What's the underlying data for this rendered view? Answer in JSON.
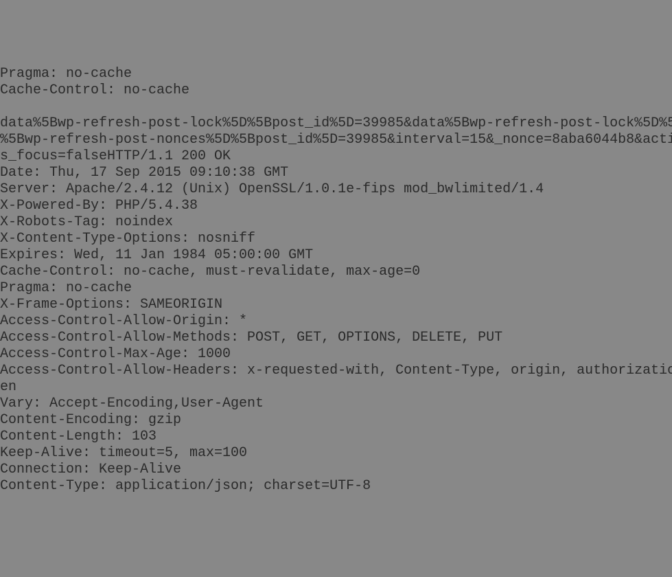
{
  "lines": [
    "Pragma: no-cache",
    "Cache-Control: no-cache",
    "",
    "data%5Bwp-refresh-post-lock%5D%5Bpost_id%5D=39985&data%5Bwp-refresh-post-lock%5D%5",
    "%5Bwp-refresh-post-nonces%5D%5Bpost_id%5D=39985&interval=15&_nonce=8aba6044b8&acti",
    "s_focus=falseHTTP/1.1 200 OK",
    "Date: Thu, 17 Sep 2015 09:10:38 GMT",
    "Server: Apache/2.4.12 (Unix) OpenSSL/1.0.1e-fips mod_bwlimited/1.4",
    "X-Powered-By: PHP/5.4.38",
    "X-Robots-Tag: noindex",
    "X-Content-Type-Options: nosniff",
    "Expires: Wed, 11 Jan 1984 05:00:00 GMT",
    "Cache-Control: no-cache, must-revalidate, max-age=0",
    "Pragma: no-cache",
    "X-Frame-Options: SAMEORIGIN",
    "Access-Control-Allow-Origin: *",
    "Access-Control-Allow-Methods: POST, GET, OPTIONS, DELETE, PUT",
    "Access-Control-Max-Age: 1000",
    "Access-Control-Allow-Headers: x-requested-with, Content-Type, origin, authorizatio",
    "en",
    "Vary: Accept-Encoding,User-Agent",
    "Content-Encoding: gzip",
    "Content-Length: 103",
    "Keep-Alive: timeout=5, max=100",
    "Connection: Keep-Alive",
    "Content-Type: application/json; charset=UTF-8"
  ]
}
